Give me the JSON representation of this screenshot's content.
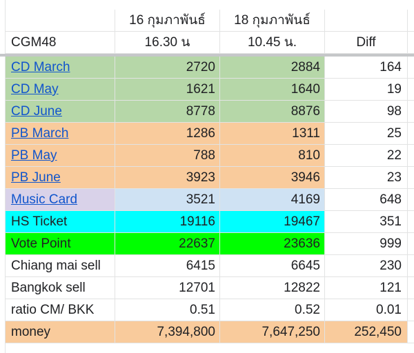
{
  "header": {
    "row1": [
      "",
      "16 กุมภาพันธ์",
      "18 กุมภาพันธ์",
      ""
    ],
    "row2": [
      "CGM48",
      "16.30 น",
      "10.45 น.",
      "Diff"
    ]
  },
  "colors": {
    "green": "#b6d7a8",
    "orange": "#f9cb9c",
    "lavender": "#d9d2e9",
    "lightblue": "#cfe2f3",
    "cyan": "#00ffff",
    "lime": "#00ff00",
    "white": "#ffffff",
    "link": "#1155cc"
  },
  "rows": [
    {
      "label": "CD March",
      "link": true,
      "v1": "2720",
      "v2": "2884",
      "diff": "164",
      "c0": "green",
      "c1": "green",
      "c2": "green"
    },
    {
      "label": "CD May",
      "link": true,
      "v1": "1621",
      "v2": "1640",
      "diff": "19",
      "c0": "green",
      "c1": "green",
      "c2": "green"
    },
    {
      "label": "CD June",
      "link": true,
      "v1": "8778",
      "v2": "8876",
      "diff": "98",
      "c0": "green",
      "c1": "green",
      "c2": "green"
    },
    {
      "label": "PB March",
      "link": true,
      "v1": "1286",
      "v2": "1311",
      "diff": "25",
      "c0": "orange",
      "c1": "orange",
      "c2": "orange"
    },
    {
      "label": "PB May",
      "link": true,
      "v1": "788",
      "v2": "810",
      "diff": "22",
      "c0": "orange",
      "c1": "orange",
      "c2": "orange"
    },
    {
      "label": "PB June",
      "link": true,
      "v1": "3923",
      "v2": "3946",
      "diff": "23",
      "c0": "orange",
      "c1": "orange",
      "c2": "orange"
    },
    {
      "label": "Music Card",
      "link": true,
      "v1": "3521",
      "v2": "4169",
      "diff": "648",
      "c0": "lavender",
      "c1": "lightblue",
      "c2": "lightblue"
    },
    {
      "label": "HS Ticket",
      "link": false,
      "v1": "19116",
      "v2": "19467",
      "diff": "351",
      "c0": "cyan",
      "c1": "cyan",
      "c2": "cyan"
    },
    {
      "label": "Vote Point",
      "link": false,
      "v1": "22637",
      "v2": "23636",
      "diff": "999",
      "c0": "lime",
      "c1": "lime",
      "c2": "lime"
    },
    {
      "label": "Chiang mai sell",
      "link": false,
      "v1": "6415",
      "v2": "6645",
      "diff": "230",
      "c0": "white",
      "c1": "white",
      "c2": "white"
    },
    {
      "label": "Bangkok sell",
      "link": false,
      "v1": "12701",
      "v2": "12822",
      "diff": "121",
      "c0": "white",
      "c1": "white",
      "c2": "white"
    },
    {
      "label": "ratio CM/ BKK",
      "link": false,
      "v1": "0.51",
      "v2": "0.52",
      "diff": "0.01",
      "c0": "white",
      "c1": "white",
      "c2": "white"
    },
    {
      "label": "money",
      "link": false,
      "v1": "7,394,800",
      "v2": "7,647,250",
      "diff": "252,450",
      "c0": "orange",
      "c1": "orange",
      "c2": "orange",
      "c3": "orange"
    }
  ]
}
